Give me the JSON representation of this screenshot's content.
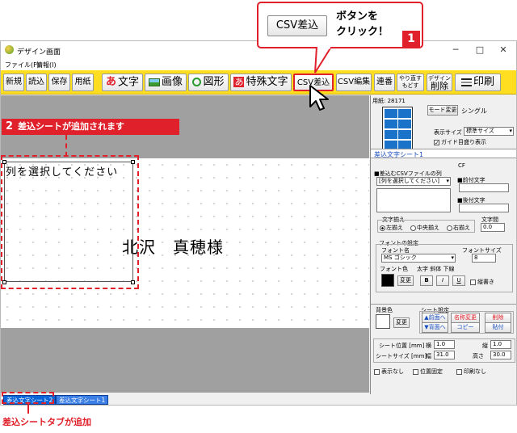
{
  "callout_top": {
    "button_label": "CSV差込",
    "text_line1": "ボタンを",
    "text_line2": "クリック！",
    "step": "1"
  },
  "callout_sheet": {
    "step": "2",
    "text": "差込シートが追加されます"
  },
  "callout_tab": {
    "text": "差込シートタブが追加"
  },
  "window": {
    "title": "デザイン画面",
    "menu": [
      "ファイル(F)",
      "情報(I)"
    ],
    "controls": {
      "minimize": "─",
      "maximize": "□",
      "close": "✕"
    }
  },
  "toolbar": {
    "new": "新規",
    "open": "読込",
    "save": "保存",
    "paper": "用紙",
    "text": "文字",
    "text_icon": "あ",
    "image": "画像",
    "shape": "図形",
    "special": "特殊文字",
    "special_icon": "あ",
    "csv_insert": "CSV差込",
    "csv_edit": "CSV編集",
    "serial": "連番",
    "redo": "やり直す",
    "undo": "もどす",
    "design_top": "デザイン",
    "design_bottom": "削除",
    "print": "印刷"
  },
  "sheet": {
    "column_text": "列を選択してください",
    "name_text": "北沢　真穂様"
  },
  "tabs": [
    "差込文字シート2",
    "差込文字シート1"
  ],
  "panel": {
    "paper": "用紙: 28171",
    "mode_button": "モード変更",
    "mode": "シングル",
    "display_size_label": "表示サイズ",
    "display_size_value": "標準サイズ",
    "guide_check": "ガイド目盛り表示",
    "sheet_title": "差込文字シート1",
    "csv_column_label": "■差込むCSVファイルの列",
    "csv_column_value": "[列を選択してください]",
    "prefix_label": "■前付文字",
    "suffix_label": "■後付文字",
    "align_label": "文字揃え",
    "align_options": [
      "左揃え",
      "中央揃え",
      "右揃え"
    ],
    "spacing_label": "文字間",
    "spacing_value": "0.0",
    "font_group_label": "フォントの設定",
    "font_name_label": "フォント名",
    "font_name_value": "MS ゴシック",
    "font_size_label": "フォントサイズ",
    "font_size_value": "8",
    "font_color_label": "フォント色",
    "font_color_button": "変更",
    "style_label": "太字 斜体 下線",
    "style_bold": "B",
    "style_italic": "I",
    "style_underline": "U",
    "vertical_label": "縦書き",
    "bg_label": "背景色",
    "bg_button": "変更",
    "sheet_settings_label": "シート設定",
    "front": "▲前面へ",
    "back": "▼背面へ",
    "rename": "名称変更",
    "copy": "コピー",
    "delete": "削除",
    "paste": "貼付",
    "pos_label": "シート位置 [mm]",
    "pos_x_label": "横",
    "pos_x": "1.0",
    "pos_y_label": "縦",
    "pos_y": "1.0",
    "size_label": "シートサイズ [mm]",
    "size_w_label": "幅",
    "size_w": "31.0",
    "size_h_label": "高さ",
    "size_h": "30.0",
    "hide": "表示なし",
    "lock": "位置固定",
    "noprint": "印刷なし",
    "cf": "CF"
  },
  "colors": {
    "toolbar": "#ffde21",
    "accent_red": "#e0202a",
    "tab_blue": "#0a64d9"
  }
}
